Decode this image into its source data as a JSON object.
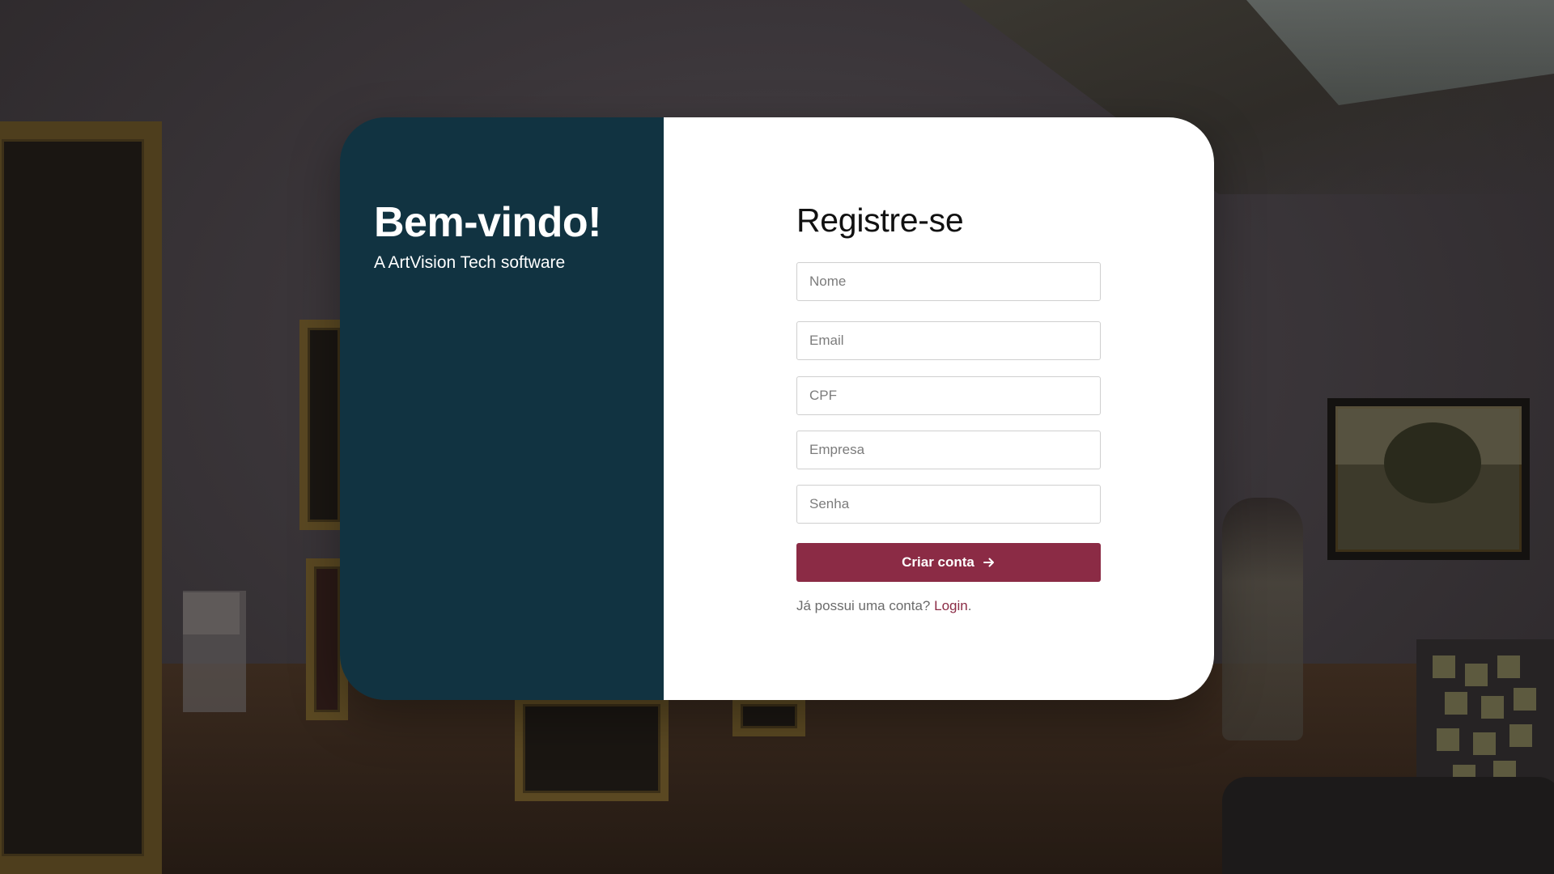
{
  "welcome": {
    "title": "Bem-vindo!",
    "subtitle": "A ArtVision Tech software"
  },
  "form": {
    "title": "Registre-se",
    "fields": {
      "nome": {
        "placeholder": "Nome",
        "value": ""
      },
      "email": {
        "placeholder": "Email",
        "value": ""
      },
      "cpf": {
        "placeholder": "CPF",
        "value": ""
      },
      "empresa": {
        "placeholder": "Empresa",
        "value": ""
      },
      "senha": {
        "placeholder": "Senha",
        "value": ""
      }
    },
    "submit_label": "Criar conta",
    "submit_icon": "arrow-right-icon",
    "login_prompt": "Já possui uma conta?",
    "login_link": "Login",
    "login_period": "."
  },
  "colors": {
    "left_panel": "#113341",
    "accent": "#8b2b45",
    "card_background": "#ffffff"
  }
}
